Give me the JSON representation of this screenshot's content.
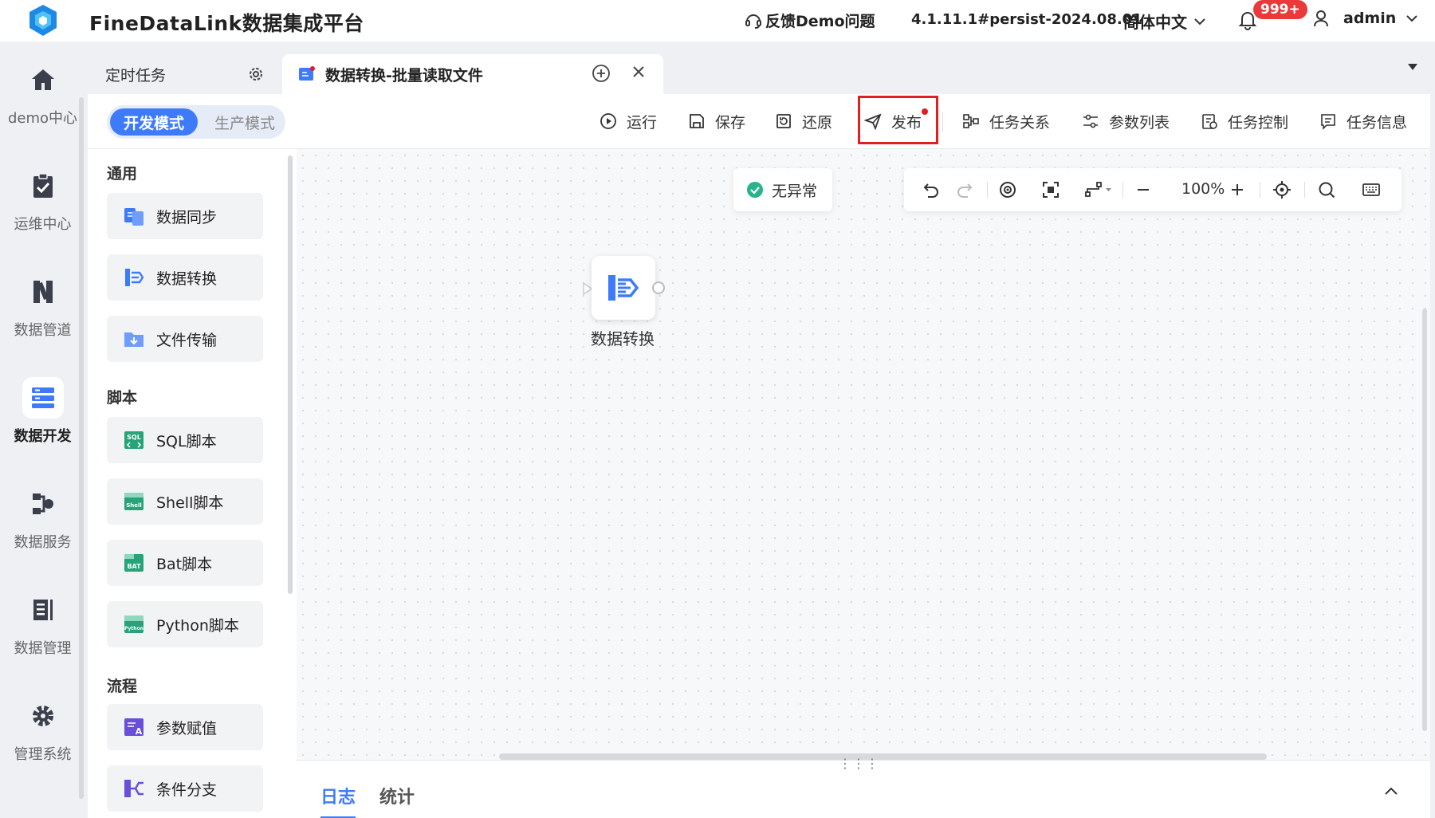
{
  "header": {
    "app_title": "FineDataLink数据集成平台",
    "feedback": "反馈Demo问题",
    "version": "4.1.11.1#persist-2024.08.01",
    "language": "简体中文",
    "notification_badge": "999+",
    "user": "admin"
  },
  "nav": {
    "items": [
      {
        "label": "demo中心",
        "icon": "home-icon"
      },
      {
        "label": "运维中心",
        "icon": "clipboard-check-icon"
      },
      {
        "label": "数据管道",
        "icon": "pipeline-icon"
      },
      {
        "label": "数据开发",
        "icon": "data-dev-icon",
        "active": true
      },
      {
        "label": "数据服务",
        "icon": "data-service-icon"
      },
      {
        "label": "数据管理",
        "icon": "data-management-icon"
      },
      {
        "label": "管理系统",
        "icon": "gear-icon"
      }
    ]
  },
  "tabs": {
    "scheduled": "定时任务",
    "current": "数据转换-批量读取文件"
  },
  "mode": {
    "dev": "开发模式",
    "prod": "生产模式"
  },
  "toolbar": {
    "run": "运行",
    "save": "保存",
    "restore": "还原",
    "publish": "发布",
    "relations": "任务关系",
    "params": "参数列表",
    "control": "任务控制",
    "info": "任务信息"
  },
  "panel": {
    "sections": {
      "general": "通用",
      "script": "脚本",
      "flow": "流程"
    },
    "general_items": [
      "数据同步",
      "数据转换",
      "文件传输"
    ],
    "script_items": [
      "SQL脚本",
      "Shell脚本",
      "Bat脚本",
      "Python脚本"
    ],
    "flow_items": [
      "参数赋值",
      "条件分支"
    ]
  },
  "canvas": {
    "status": "无异常",
    "zoom": "100%",
    "node_label": "数据转换"
  },
  "log": {
    "tab_log": "日志",
    "tab_stats": "统计"
  },
  "colors": {
    "accent": "#3e7bfa",
    "highlight_border": "#e02020",
    "status_ok": "#27b48a"
  }
}
